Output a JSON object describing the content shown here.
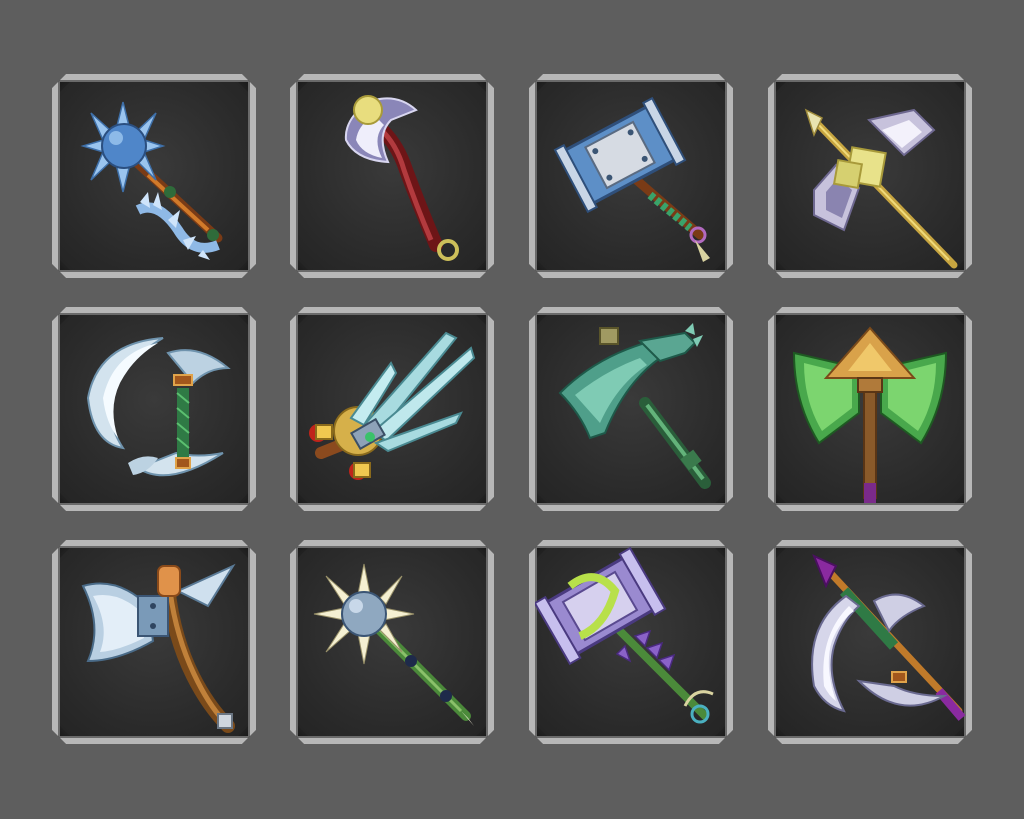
{
  "inventory": {
    "slots": [
      {
        "icon": "spiked-mace-icon"
      },
      {
        "icon": "scythe-axe-icon"
      },
      {
        "icon": "war-hammer-icon"
      },
      {
        "icon": "double-axe-spear-icon"
      },
      {
        "icon": "crescent-blade-icon"
      },
      {
        "icon": "trident-claw-icon"
      },
      {
        "icon": "jade-pickaxe-icon"
      },
      {
        "icon": "green-double-axe-icon"
      },
      {
        "icon": "spear-axe-icon"
      },
      {
        "icon": "morning-star-icon"
      },
      {
        "icon": "vine-hammer-icon"
      },
      {
        "icon": "purple-crescent-axe-icon"
      }
    ]
  },
  "colors": {
    "background": "#5e5e5e",
    "slot_fill": "#2d2d2d",
    "slot_border": "#b7b7b7"
  }
}
